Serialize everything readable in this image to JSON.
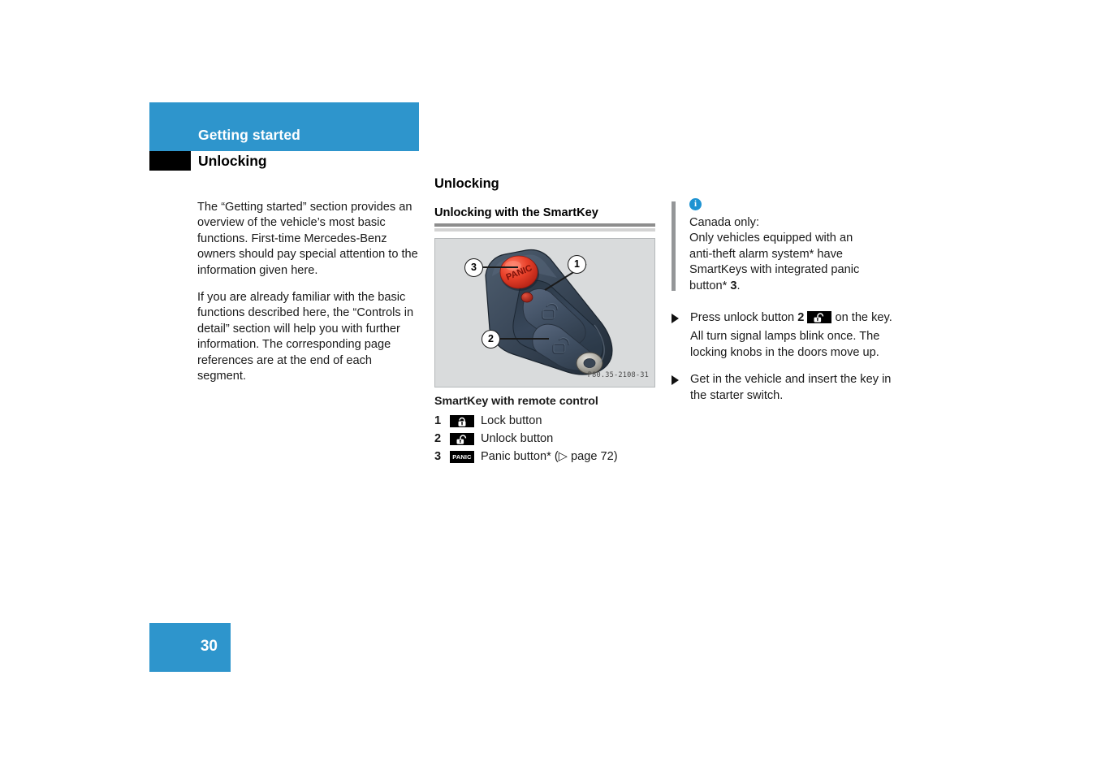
{
  "page": {
    "number": "30",
    "accent_color": "#2e95cc",
    "tab_color": "#000000"
  },
  "header": {
    "title": "Getting started",
    "subtitle": "Unlocking"
  },
  "left_column": {
    "paragraphs": [
      "The “Getting started” section provides an overview of the vehicle’s most basic functions. First-time Mercedes-Benz owners should pay special attention to the information given here.",
      "If you are already familiar with the basic functions described here, the “Controls in detail” section will help you with further information. The corresponding page references are at the end of each segment."
    ]
  },
  "middle_column": {
    "section_title": "Unlocking",
    "sub_title": "Unlocking with the SmartKey",
    "figure": {
      "id_label": "P80.35-2108-31",
      "callouts": [
        "3",
        "1",
        "2"
      ],
      "panic_label": "PANIC",
      "alt": "SmartKey remote control fob with numbered callouts"
    },
    "figure_caption": "SmartKey with remote control",
    "legend": [
      {
        "number": "1",
        "icon": "lock-icon",
        "text": "Lock button"
      },
      {
        "number": "2",
        "icon": "unlock-icon",
        "text": "Unlock button"
      },
      {
        "number": "3",
        "icon": "panic-icon",
        "text": "Panic button* (▷ page 72)"
      }
    ]
  },
  "right_column": {
    "info_note": {
      "icon": "info-icon",
      "text": "Canada only:\nOnly vehicles equipped with an anti-theft alarm system* have SmartKeys with integrated panic button* 3.",
      "lines": [
        "Canada only:",
        "Only vehicles equipped with an",
        "anti-theft alarm system* have",
        "SmartKeys with integrated panic",
        "button* 3."
      ],
      "bold_number": "3"
    },
    "steps": [
      {
        "icon": "arrow-bullet-icon",
        "text_before": "Press unlock button ",
        "bold_number": "2",
        "inline_icon": "unlock-icon",
        "text_after": " on the key.",
        "sub_text": "All turn signal lamps blink once. The locking knobs in the doors move up."
      },
      {
        "icon": "arrow-bullet-icon",
        "text_before": "Get in the vehicle and insert the key in the starter switch.",
        "bold_number": "",
        "inline_icon": "",
        "text_after": "",
        "sub_text": ""
      }
    ]
  }
}
